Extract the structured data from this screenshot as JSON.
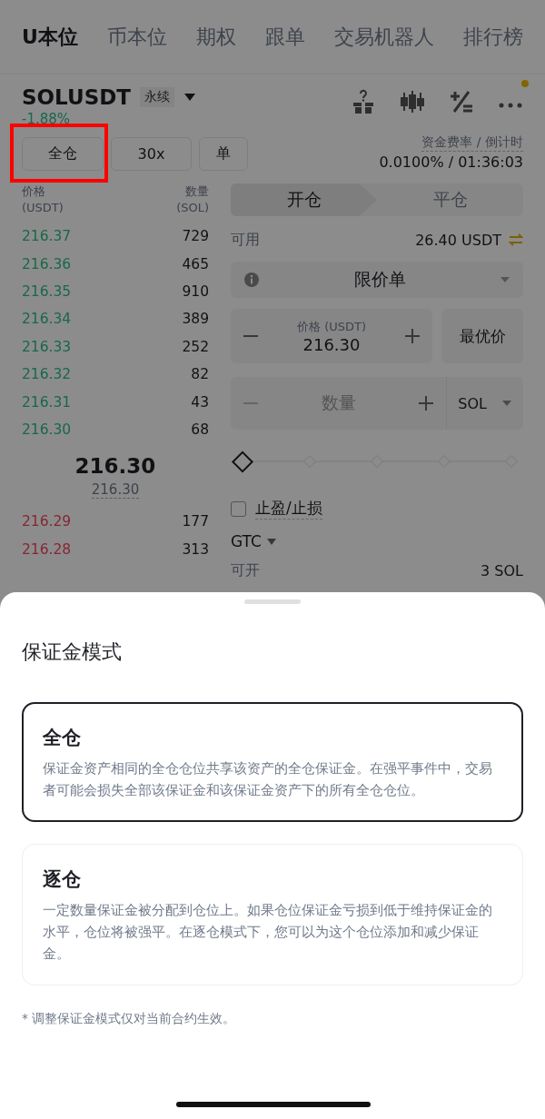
{
  "tabs": [
    {
      "label": "U本位",
      "selected": true
    },
    {
      "label": "币本位",
      "selected": false
    },
    {
      "label": "期权",
      "selected": false
    },
    {
      "label": "跟单",
      "selected": false
    },
    {
      "label": "交易机器人",
      "selected": false
    },
    {
      "label": "排行榜",
      "selected": false
    }
  ],
  "symbol": {
    "name": "SOLUSDT",
    "tag": "永续",
    "change": "-1.88%"
  },
  "margin_buttons": [
    {
      "label": "全仓",
      "highlighted": true
    },
    {
      "label": "30x",
      "highlighted": false
    },
    {
      "label": "单",
      "highlighted": false
    }
  ],
  "funding": {
    "label": "资金费率 / 倒计时",
    "value": "0.0100% / 01:36:03"
  },
  "order_book": {
    "price_header": "价格",
    "price_unit": "(USDT)",
    "qty_header": "数量",
    "qty_unit": "(SOL)",
    "asks": [
      {
        "price": "216.37",
        "qty": "729"
      },
      {
        "price": "216.36",
        "qty": "465"
      },
      {
        "price": "216.35",
        "qty": "910"
      },
      {
        "price": "216.34",
        "qty": "389"
      },
      {
        "price": "216.33",
        "qty": "252"
      },
      {
        "price": "216.32",
        "qty": "82"
      },
      {
        "price": "216.31",
        "qty": "43"
      },
      {
        "price": "216.30",
        "qty": "68"
      }
    ],
    "last_price": "216.30",
    "mark_price": "216.30",
    "bids": [
      {
        "price": "216.29",
        "qty": "177"
      },
      {
        "price": "216.28",
        "qty": "313"
      }
    ]
  },
  "order_form": {
    "sides": [
      {
        "label": "开仓",
        "selected": true
      },
      {
        "label": "平仓",
        "selected": false
      }
    ],
    "available_label": "可用",
    "available_value": "26.40 USDT",
    "order_type": "限价单",
    "price_label": "价格 (USDT)",
    "price_value": "216.30",
    "best_price": "最优价",
    "qty_placeholder": "数量",
    "qty_unit": "SOL",
    "slider": {
      "level": 0
    },
    "tpsl": {
      "label": "止盈/止损",
      "checked": false
    },
    "tif": "GTC",
    "max_label": "可开",
    "max_value": "3 SOL"
  },
  "sheet": {
    "title": "保证金模式",
    "options": [
      {
        "title": "全仓",
        "description": "保证金资产相同的全仓仓位共享该资产的全仓保证金。在强平事件中，交易者可能会损失全部该保证金和该保证金资产下的所有全仓仓位。",
        "selected": true
      },
      {
        "title": "逐仓",
        "description": "一定数量保证金被分配到仓位上。如果仓位保证金亏损到低于维持保证金的水平，仓位将被强平。在逐仓模式下，您可以为这个仓位添加和减少保证金。",
        "selected": false
      }
    ],
    "note": "* 调整保证金模式仅对当前合约生效。"
  }
}
